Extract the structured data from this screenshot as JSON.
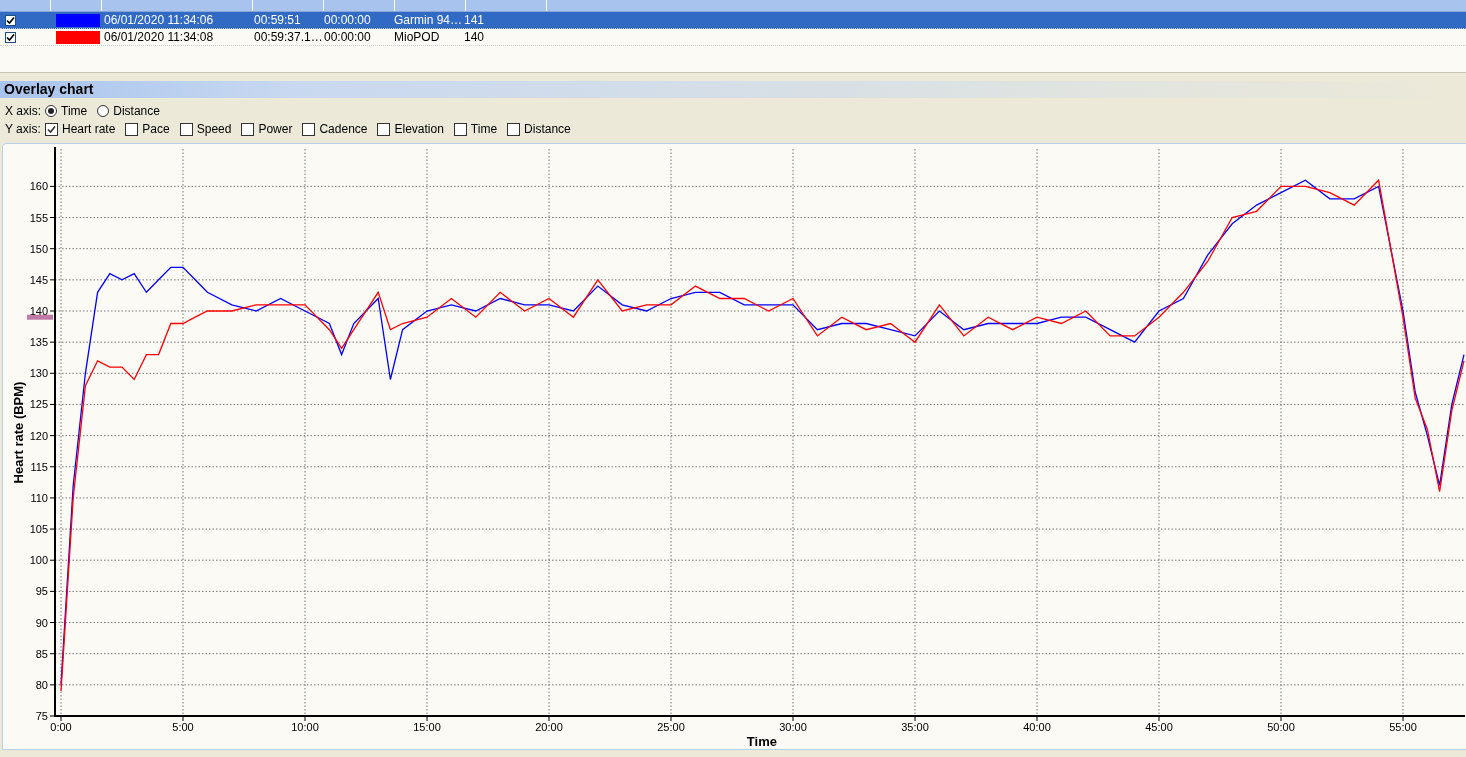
{
  "activities": {
    "rows": [
      {
        "checked": true,
        "selected": true,
        "color": "#0000ff",
        "start": "06/01/2020 11:34:06",
        "duration": "00:59:51",
        "column_5": "00:00:00",
        "device": "Garmin 94…",
        "heart_rate": "141"
      },
      {
        "checked": true,
        "selected": false,
        "color": "#ff0000",
        "start": "06/01/2020 11:34:08",
        "duration": "00:59:37.1…",
        "column_5": "00:00:00",
        "device": "MioPOD",
        "heart_rate": "140"
      }
    ]
  },
  "overlay_chart": {
    "title": "Overlay chart",
    "x_axis": {
      "label": "X axis:",
      "options": [
        {
          "label": "Time",
          "selected": true
        },
        {
          "label": "Distance",
          "selected": false
        }
      ]
    },
    "y_axis": {
      "label": "Y axis:",
      "options": [
        {
          "label": "Heart rate",
          "checked": true
        },
        {
          "label": "Pace",
          "checked": false
        },
        {
          "label": "Speed",
          "checked": false
        },
        {
          "label": "Power",
          "checked": false
        },
        {
          "label": "Cadence",
          "checked": false
        },
        {
          "label": "Elevation",
          "checked": false
        },
        {
          "label": "Time",
          "checked": false
        },
        {
          "label": "Distance",
          "checked": false
        }
      ]
    },
    "chart_data": {
      "type": "line",
      "grid": true,
      "xlabel": "Time",
      "ylabel": "Heart rate (BPM)",
      "x": [
        0,
        0.5,
        1,
        1.5,
        2,
        2.5,
        3,
        3.5,
        4,
        4.5,
        5,
        5.5,
        6,
        7,
        8,
        9,
        10,
        11,
        11.5,
        12,
        13,
        13.5,
        14,
        15,
        16,
        17,
        18,
        19,
        20,
        21,
        22,
        23,
        24,
        25,
        26,
        27,
        28,
        29,
        30,
        31,
        32,
        33,
        34,
        35,
        36,
        37,
        38,
        39,
        40,
        41,
        42,
        43,
        44,
        45,
        46,
        47,
        48,
        49,
        50,
        51,
        52,
        53,
        54,
        55,
        55.5,
        56,
        56.5,
        57,
        57.5
      ],
      "series": [
        {
          "color": "#0000ff",
          "values": [
            80,
            112,
            130,
            143,
            146,
            145,
            146,
            143,
            145,
            147,
            147,
            145,
            143,
            141,
            140,
            142,
            140,
            138,
            133,
            138,
            142,
            129,
            137,
            140,
            141,
            140,
            142,
            141,
            141,
            140,
            144,
            141,
            140,
            142,
            143,
            143,
            141,
            141,
            141,
            137,
            138,
            138,
            137,
            136,
            140,
            137,
            138,
            138,
            138,
            139,
            139,
            137,
            135,
            140,
            142,
            149,
            154,
            157,
            159,
            161,
            158,
            158,
            160,
            140,
            127,
            120,
            112,
            125,
            133
          ]
        },
        {
          "color": "#ff0000",
          "values": [
            79,
            110,
            128,
            132,
            131,
            131,
            129,
            133,
            133,
            138,
            138,
            139,
            140,
            140,
            141,
            141,
            141,
            137,
            134,
            137,
            143,
            137,
            138,
            139,
            142,
            139,
            143,
            140,
            142,
            139,
            145,
            140,
            141,
            141,
            144,
            142,
            142,
            140,
            142,
            136,
            139,
            137,
            138,
            135,
            141,
            136,
            139,
            137,
            139,
            138,
            140,
            136,
            136,
            139,
            143,
            148,
            155,
            156,
            160,
            160,
            159,
            157,
            161,
            139,
            126,
            121,
            111,
            124,
            132
          ]
        }
      ],
      "xlim": [
        -0.25,
        57.7
      ],
      "ylim": [
        75,
        166
      ],
      "xticks": [
        {
          "value": 0,
          "label": "0:00"
        },
        {
          "value": 5,
          "label": "5:00"
        },
        {
          "value": 10,
          "label": "10:00"
        },
        {
          "value": 15,
          "label": "15:00"
        },
        {
          "value": 20,
          "label": "20:00"
        },
        {
          "value": 25,
          "label": "25:00"
        },
        {
          "value": 30,
          "label": "30:00"
        },
        {
          "value": 35,
          "label": "35:00"
        },
        {
          "value": 40,
          "label": "40:00"
        },
        {
          "value": 45,
          "label": "45:00"
        },
        {
          "value": 50,
          "label": "50:00"
        },
        {
          "value": 55,
          "label": "55:00"
        }
      ],
      "yticks": [
        75,
        80,
        85,
        90,
        95,
        100,
        105,
        110,
        115,
        120,
        125,
        130,
        135,
        140,
        145,
        150,
        155,
        160
      ]
    }
  }
}
